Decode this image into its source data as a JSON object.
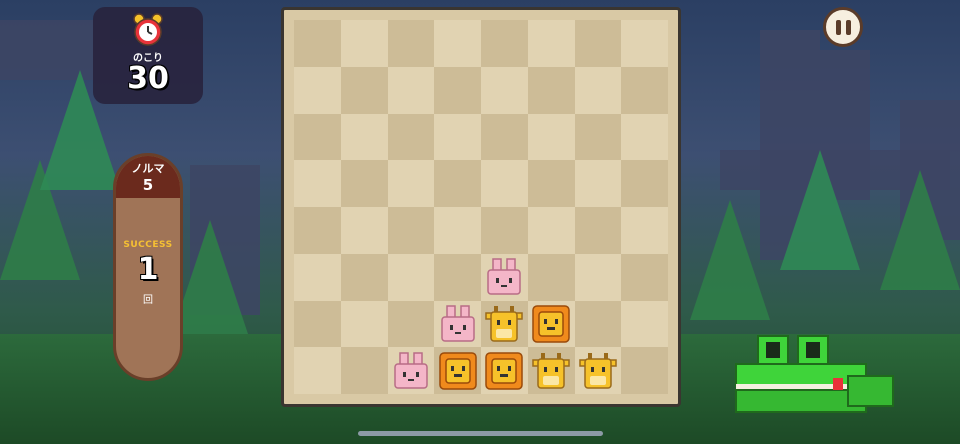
{
  "timer": {
    "label": "のこり",
    "value": "30",
    "icon": "alarm-clock-icon"
  },
  "quota": {
    "label": "ノルマ",
    "value": "5"
  },
  "success": {
    "label": "SUCCESS",
    "value": "1",
    "unit": "回"
  },
  "controls": {
    "pause_icon": "pause-icon"
  },
  "board": {
    "rows": 8,
    "cols": 8,
    "pieces": [
      {
        "row": 5,
        "col": 4,
        "kind": "rabbit"
      },
      {
        "row": 6,
        "col": 3,
        "kind": "rabbit"
      },
      {
        "row": 6,
        "col": 4,
        "kind": "giraffe"
      },
      {
        "row": 6,
        "col": 5,
        "kind": "lion"
      },
      {
        "row": 7,
        "col": 2,
        "kind": "rabbit"
      },
      {
        "row": 7,
        "col": 3,
        "kind": "lion"
      },
      {
        "row": 7,
        "col": 4,
        "kind": "lion"
      },
      {
        "row": 7,
        "col": 5,
        "kind": "giraffe"
      },
      {
        "row": 7,
        "col": 6,
        "kind": "giraffe"
      }
    ]
  },
  "colors": {
    "rabbit": "#f4b6c8",
    "lion": "#f08a1c",
    "giraffe": "#f6c22a",
    "crocodile": "#3fd43a"
  }
}
